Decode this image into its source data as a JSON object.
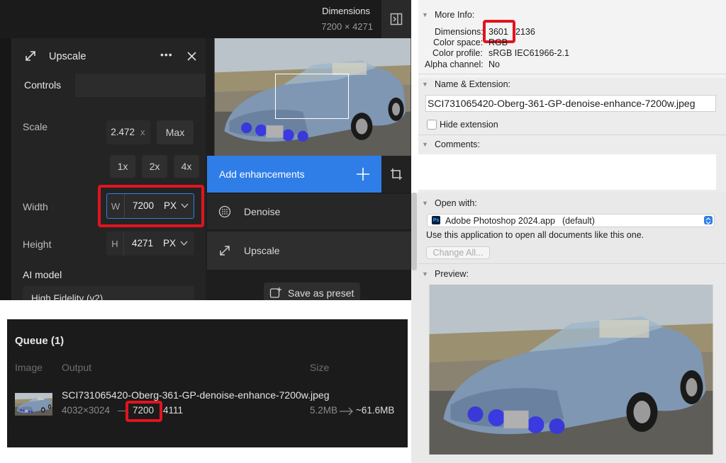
{
  "topaz": {
    "dimensions_title": "Dimensions",
    "dimensions_value": "7200 × 4271",
    "panel_title": "Upscale",
    "more_icon": "•••",
    "tab_controls": "Controls",
    "scale_label": "Scale",
    "scale_value": "2.472",
    "scale_x": "x",
    "max_label": "Max",
    "preset_1x": "1x",
    "preset_2x": "2x",
    "preset_4x": "4x",
    "width_label": "Width",
    "width_prefix": "W",
    "width_value": "7200",
    "width_unit": "PX",
    "height_label": "Height",
    "height_prefix": "H",
    "height_value": "4271",
    "height_unit": "PX",
    "ai_model_label": "AI model",
    "ai_model_value": "High Fidelity (v2)",
    "add_enhancements": "Add enhancements",
    "denoise": "Denoise",
    "upscale": "Upscale",
    "save_preset": "Save as preset"
  },
  "queue": {
    "title": "Queue (1)",
    "col_image": "Image",
    "col_output": "Output",
    "col_size": "Size",
    "filename": "SCI731065420-Oberg-361-GP-denoise-enhance-7200w.jpeg",
    "orig_dims": "4032×3024",
    "dash": "—",
    "new_w": "7200",
    "new_h": "4111",
    "size_from": "5.2MB",
    "size_to": "~61.6MB"
  },
  "info": {
    "more_info": "More Info:",
    "dimensions_label": "Dimensions:",
    "dimensions_w": "3601",
    "dimensions_h": "2136",
    "color_space_label": "Color space:",
    "color_space_value": "RGB",
    "color_profile_label": "Color profile:",
    "color_profile_value": "sRGB IEC61966-2.1",
    "alpha_label": "Alpha channel:",
    "alpha_value": "No",
    "name_ext": "Name & Extension:",
    "filename": "SCI731065420-Oberg-361-GP-denoise-enhance-7200w.jpeg",
    "hide_ext": "Hide extension",
    "comments": "Comments:",
    "open_with": "Open with:",
    "app_name": "Adobe Photoshop 2024.app",
    "app_default": "(default)",
    "app_badge": "Ps",
    "use_app": "Use this application to open all documents like this one.",
    "change_all": "Change All...",
    "preview": "Preview:"
  },
  "colors": {
    "accent_blue": "#2f7ee8",
    "highlight_red": "#e1141f"
  }
}
